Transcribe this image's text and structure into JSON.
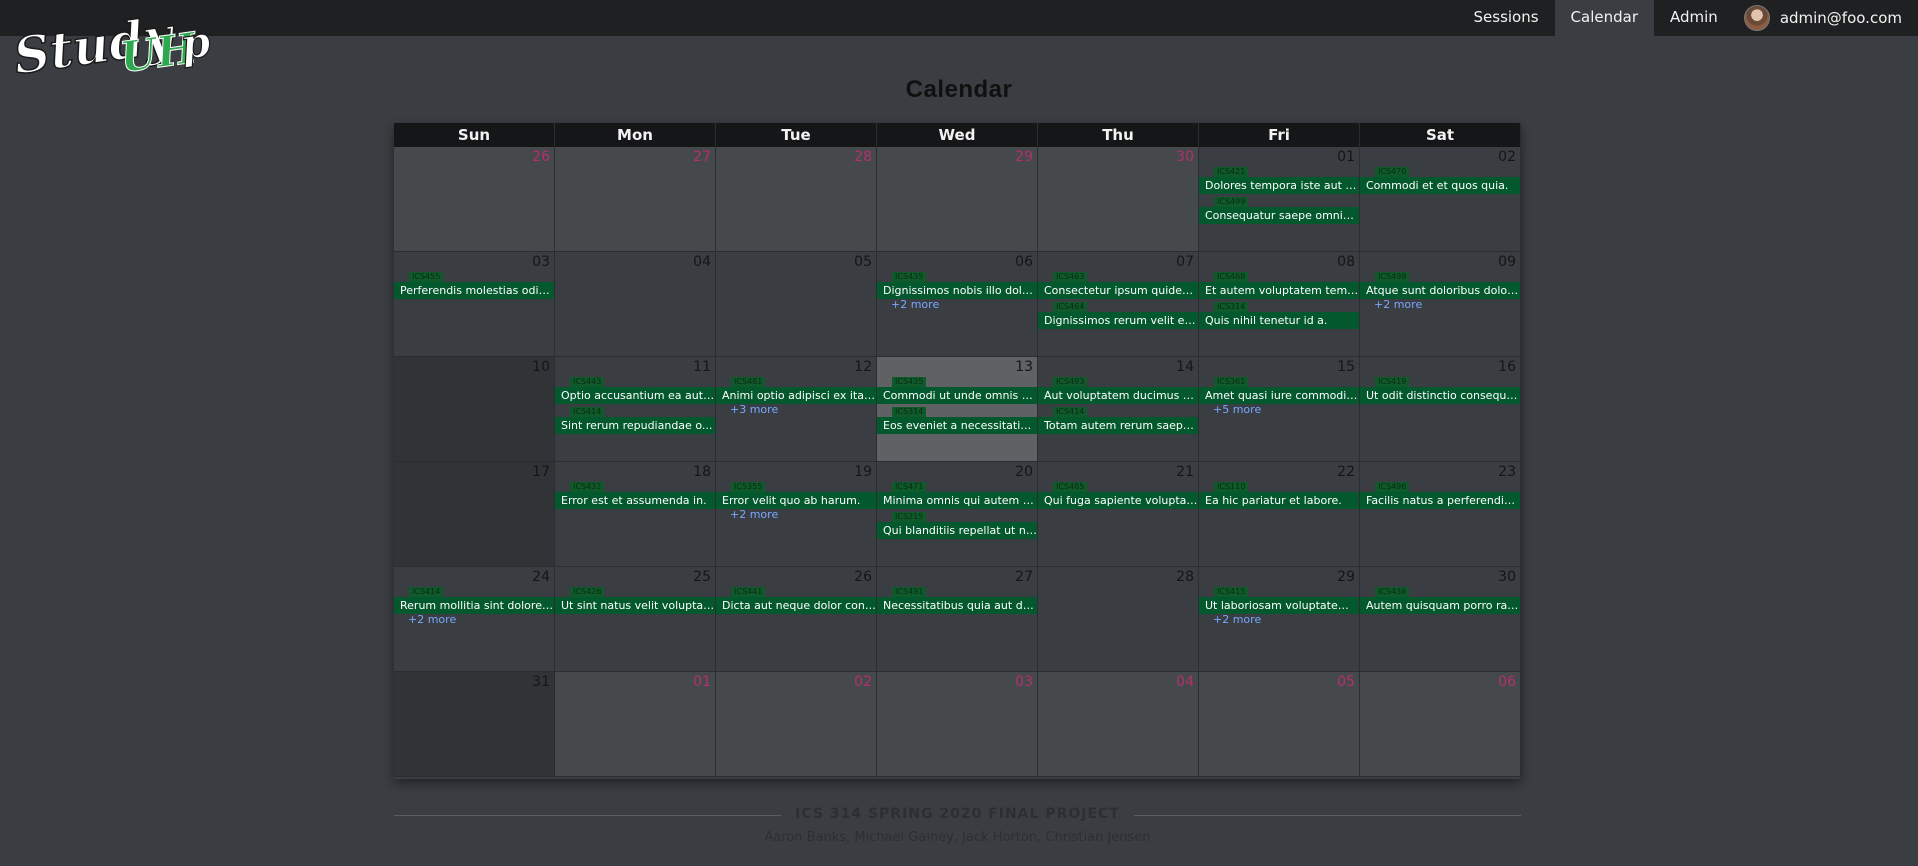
{
  "nav": {
    "items": [
      "Sessions",
      "Calendar",
      "Admin"
    ],
    "active": "Calendar",
    "user_email": "admin@foo.com"
  },
  "logo": {
    "text": "StudyUHHp",
    "accent": "#2ea84e"
  },
  "page_title": "Calendar",
  "calendar": {
    "days_of_week": [
      "Sun",
      "Mon",
      "Tue",
      "Wed",
      "Thu",
      "Fri",
      "Sat"
    ],
    "weeks": [
      [
        {
          "num": "26",
          "other": true,
          "events": []
        },
        {
          "num": "27",
          "other": true,
          "events": []
        },
        {
          "num": "28",
          "other": true,
          "events": []
        },
        {
          "num": "29",
          "other": true,
          "events": []
        },
        {
          "num": "30",
          "other": true,
          "events": []
        },
        {
          "num": "01",
          "events": [
            {
              "tag": "ICS421",
              "title": "Dolores tempora iste aut n..."
            },
            {
              "tag": "ICS499",
              "title": "Consequatur saepe omnis ..."
            }
          ]
        },
        {
          "num": "02",
          "events": [
            {
              "tag": "ICS470",
              "title": "Commodi et et quos quia."
            }
          ]
        }
      ],
      [
        {
          "num": "03",
          "events": [
            {
              "tag": "ICS455",
              "title": "Perferendis molestias odio ..."
            }
          ]
        },
        {
          "num": "04",
          "events": []
        },
        {
          "num": "05",
          "events": []
        },
        {
          "num": "06",
          "events": [
            {
              "tag": "ICS435",
              "title": "Dignissimos nobis illo dolo..."
            }
          ],
          "more": "+2 more"
        },
        {
          "num": "07",
          "events": [
            {
              "tag": "ICS463",
              "title": "Consectetur ipsum quidem..."
            },
            {
              "tag": "ICS464",
              "title": "Dignissimos rerum velit est..."
            }
          ]
        },
        {
          "num": "08",
          "events": [
            {
              "tag": "ICS468",
              "title": "Et autem voluptatem temp..."
            },
            {
              "tag": "ICS314",
              "title": "Quis nihil tenetur id a."
            }
          ]
        },
        {
          "num": "09",
          "events": [
            {
              "tag": "ICS499",
              "title": "Atque sunt doloribus dolor..."
            }
          ],
          "more": "+2 more"
        }
      ],
      [
        {
          "num": "10",
          "events": []
        },
        {
          "num": "11",
          "events": [
            {
              "tag": "ICS443",
              "title": "Optio accusantium ea aut ..."
            },
            {
              "tag": "ICS414",
              "title": "Sint rerum repudiandae o..."
            }
          ]
        },
        {
          "num": "12",
          "events": [
            {
              "tag": "ICS481",
              "title": "Animi optio adipisci ex itaq..."
            }
          ],
          "more": "+3 more"
        },
        {
          "num": "13",
          "today": true,
          "events": [
            {
              "tag": "ICS435",
              "title": "Commodi ut unde omnis a..."
            },
            {
              "tag": "ICS314",
              "title": "Eos eveniet a necessitatibu..."
            }
          ]
        },
        {
          "num": "14",
          "events": [
            {
              "tag": "ICS493",
              "title": "Aut voluptatem ducimus n..."
            },
            {
              "tag": "ICS414",
              "title": "Totam autem rerum saepe..."
            }
          ]
        },
        {
          "num": "15",
          "events": [
            {
              "tag": "ICS361",
              "title": "Amet quasi iure commodi ..."
            }
          ],
          "more": "+5 more"
        },
        {
          "num": "16",
          "events": [
            {
              "tag": "ICS419",
              "title": "Ut odit distinctio consequa..."
            }
          ]
        }
      ],
      [
        {
          "num": "17",
          "events": []
        },
        {
          "num": "18",
          "events": [
            {
              "tag": "ICS432",
              "title": "Error est et assumenda in."
            }
          ]
        },
        {
          "num": "19",
          "events": [
            {
              "tag": "ICS355",
              "title": "Error velit quo ab harum."
            }
          ],
          "more": "+2 more"
        },
        {
          "num": "20",
          "events": [
            {
              "tag": "ICS471",
              "title": "Minima omnis qui autem d..."
            },
            {
              "tag": "ICS215",
              "title": "Qui blanditiis repellat ut ne..."
            }
          ]
        },
        {
          "num": "21",
          "events": [
            {
              "tag": "ICS485",
              "title": "Qui fuga sapiente voluptat..."
            }
          ]
        },
        {
          "num": "22",
          "events": [
            {
              "tag": "ICS110",
              "title": "Ea hic pariatur et labore."
            }
          ]
        },
        {
          "num": "23",
          "events": [
            {
              "tag": "ICS496",
              "title": "Facilis natus a perferendis ..."
            }
          ]
        }
      ],
      [
        {
          "num": "24",
          "events": [
            {
              "tag": "ICS414",
              "title": "Rerum mollitia sint dolore ..."
            }
          ],
          "more": "+2 more"
        },
        {
          "num": "25",
          "events": [
            {
              "tag": "ICS426",
              "title": "Ut sint natus velit voluptat..."
            }
          ]
        },
        {
          "num": "26",
          "events": [
            {
              "tag": "ICS441",
              "title": "Dicta aut neque dolor cons..."
            }
          ]
        },
        {
          "num": "27",
          "events": [
            {
              "tag": "ICS491",
              "title": "Necessitatibus quia aut dol..."
            }
          ]
        },
        {
          "num": "28",
          "events": []
        },
        {
          "num": "29",
          "events": [
            {
              "tag": "ICS415",
              "title": "Ut laboriosam voluptatem ..."
            }
          ],
          "more": "+2 more"
        },
        {
          "num": "30",
          "events": [
            {
              "tag": "ICS436",
              "title": "Autem quisquam porro rat..."
            }
          ]
        }
      ],
      [
        {
          "num": "31",
          "events": []
        },
        {
          "num": "01",
          "other": true,
          "events": []
        },
        {
          "num": "02",
          "other": true,
          "events": []
        },
        {
          "num": "03",
          "other": true,
          "events": []
        },
        {
          "num": "04",
          "other": true,
          "events": []
        },
        {
          "num": "05",
          "other": true,
          "events": []
        },
        {
          "num": "06",
          "other": true,
          "events": []
        }
      ]
    ]
  },
  "footer": {
    "title": "ICS 314 SPRING 2020 FINAL PROJECT",
    "credits": "Aaron Banks, Michael Gainey, Jack Horton, Christian Jensen"
  },
  "colors": {
    "event_bg": "#03592d",
    "other_month_num": "#b3306e",
    "more_link": "#7aa6ff",
    "navbar_bg": "#1e2022"
  }
}
